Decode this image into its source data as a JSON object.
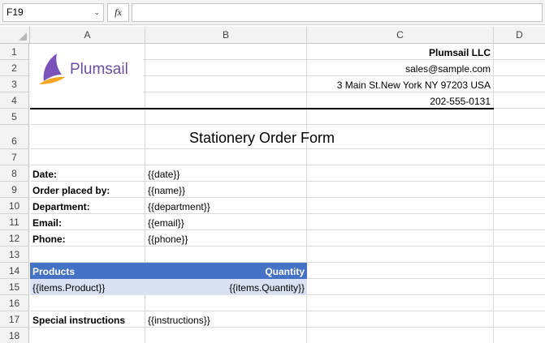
{
  "formula_bar": {
    "name_box": "F19",
    "fx_label": "fx",
    "formula": ""
  },
  "columns": [
    "A",
    "B",
    "C",
    "D"
  ],
  "rows": [
    "1",
    "2",
    "3",
    "4",
    "5",
    "6",
    "7",
    "8",
    "9",
    "10",
    "11",
    "12",
    "13",
    "14",
    "15",
    "16",
    "17",
    "18"
  ],
  "logo": {
    "text": "Plumsail",
    "colors": {
      "purple": "#6b4ea1",
      "orange": "#f5a623"
    }
  },
  "company": {
    "name": "Plumsail LLC",
    "email": "sales@sample.com",
    "address": "3 Main St.New York NY 97203 USA",
    "phone": "202-555-0131"
  },
  "form": {
    "title": "Stationery Order Form",
    "fields": [
      {
        "label": "Date:",
        "value": "{{date}}"
      },
      {
        "label": "Order placed by:",
        "value": "{{name}}"
      },
      {
        "label": "Department:",
        "value": "{{department}}"
      },
      {
        "label": "Email:",
        "value": "{{email}}"
      },
      {
        "label": "Phone:",
        "value": "{{phone}}"
      }
    ],
    "table": {
      "header_products": "Products",
      "header_quantity": "Quantity",
      "row_product": "{{items.Product}}",
      "row_quantity": "{{items.Quantity}}",
      "colors": {
        "header_bg": "#4472c4",
        "row_bg": "#d9e1f2"
      }
    },
    "special_label": "Special instructions",
    "special_value": "{{instructions}}"
  }
}
